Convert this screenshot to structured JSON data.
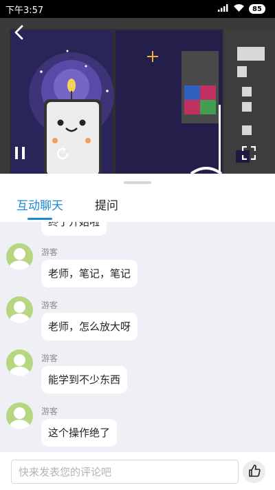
{
  "status_bar": {
    "time": "下午3:57",
    "battery": "85",
    "icons": [
      "signal-icon",
      "wifi-icon",
      "battery-icon"
    ]
  },
  "video": {
    "icons": [
      "back-arrow-icon",
      "pause-icon",
      "refresh-icon",
      "fullscreen-icon"
    ]
  },
  "tabs": [
    {
      "label": "互动聊天",
      "active": true
    },
    {
      "label": "提问",
      "active": false
    }
  ],
  "chat": {
    "partial_message": "终于开始啦",
    "messages": [
      {
        "sender": "游客",
        "text": "老师，笔记，笔记"
      },
      {
        "sender": "游客",
        "text": "老师，怎么放大呀"
      },
      {
        "sender": "游客",
        "text": "能学到不少东西"
      },
      {
        "sender": "游客",
        "text": "这个操作绝了"
      }
    ]
  },
  "input": {
    "placeholder": "快来发表您的评论吧"
  },
  "colors": {
    "accent": "#1a8ad6",
    "chat_background": "#eef0f6",
    "avatar": "#b6d67f"
  }
}
